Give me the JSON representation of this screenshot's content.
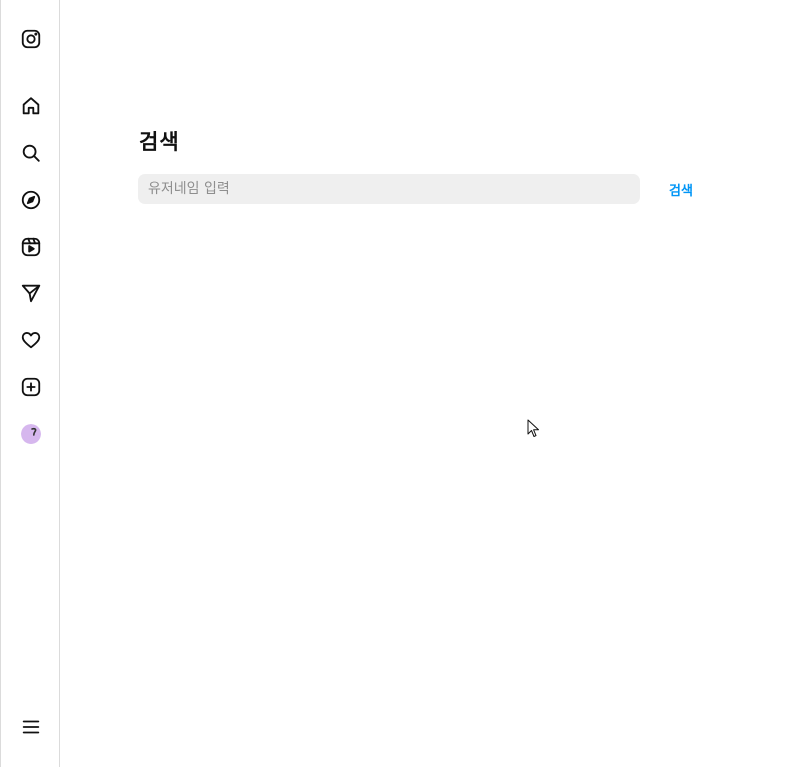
{
  "sidebar": {
    "items": [
      {
        "name": "instagram-logo-icon"
      },
      {
        "name": "home-icon"
      },
      {
        "name": "search-icon"
      },
      {
        "name": "explore-icon"
      },
      {
        "name": "reels-icon"
      },
      {
        "name": "direct-message-icon"
      },
      {
        "name": "notifications-heart-icon"
      },
      {
        "name": "create-plus-icon"
      },
      {
        "name": "profile-avatar"
      },
      {
        "name": "more-menu-icon"
      }
    ]
  },
  "main": {
    "title": "검색",
    "search": {
      "placeholder": "유저네임 입력",
      "value": ""
    },
    "search_button_label": "검색"
  },
  "colors": {
    "accent": "#0095f6",
    "input_bg": "#efefef",
    "border": "#dbdbdb",
    "avatar": "#d6b7ee"
  }
}
